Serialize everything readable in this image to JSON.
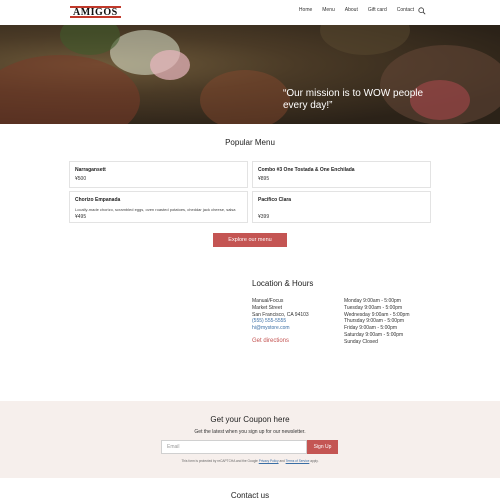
{
  "header": {
    "logo": "AMIGOS",
    "nav": [
      "Home",
      "Menu",
      "About",
      "Gift card",
      "Contact"
    ],
    "search_icon": "search-icon"
  },
  "hero": {
    "quote_line1": "“Our mission is to WOW people",
    "quote_line2": "every day!”"
  },
  "popular_menu": {
    "title": "Popular Menu",
    "items": [
      {
        "name": "Narragansett",
        "description": "",
        "price": "¥500"
      },
      {
        "name": "Combo #3 One Tostada & One Enchilada",
        "description": "",
        "price": "¥895"
      },
      {
        "name": "Chorizo Empanada",
        "description": "Locally-made chorizo, scrambled eggs, oven roasted potatoes, cheddar jack cheese, salsa",
        "price": "¥495"
      },
      {
        "name": "Pacifico Clara",
        "description": "",
        "price": "¥399"
      }
    ],
    "explore_label": "Explore our menu"
  },
  "location": {
    "title": "Location & Hours",
    "address_lines": [
      "Manual/Focus",
      "Market Street",
      "San Francisco, CA 94103"
    ],
    "phone": "(555) 555-5555",
    "email": "hi@mystore.com",
    "directions_label": "Get directions",
    "hours": [
      "Monday 9:00am - 5:00pm",
      "Tuesday 9:00am - 5:00pm",
      "Wednesday 9:00am - 5:00pm",
      "Thursday 9:00am - 5:00pm",
      "Friday 9:00am - 5:00pm",
      "Saturday 9:00am - 5:00pm",
      "Sunday Closed"
    ]
  },
  "coupon": {
    "title": "Get your Coupon here",
    "subtitle": "Get the latest when you sign up for our newsletter.",
    "email_placeholder": "Email",
    "signup_label": "Sign Up",
    "legal_prefix": "This form is protected by reCAPTCHA and the Google",
    "privacy_label": "Privacy Policy",
    "legal_and": "and",
    "terms_label": "Terms of Service",
    "legal_suffix": "apply."
  },
  "contact": {
    "title": "Contact us"
  },
  "colors": {
    "accent": "#c45553",
    "link": "#3a6ea5",
    "coupon_bg": "#f6efec"
  }
}
